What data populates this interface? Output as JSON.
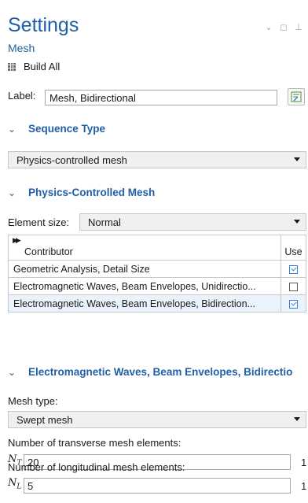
{
  "header": {
    "title": "Settings",
    "subtitle": "Mesh",
    "build_all": "Build All"
  },
  "label_field": {
    "label": "Label:",
    "value": "Mesh, Bidirectional"
  },
  "sections": {
    "sequence_type": {
      "title": "Sequence Type",
      "selected": "Physics-controlled mesh"
    },
    "physics_mesh": {
      "title": "Physics-Controlled Mesh",
      "element_size_label": "Element size:",
      "element_size_value": "Normal",
      "table": {
        "col_contributor": "Contributor",
        "col_use": "Use",
        "rows": [
          {
            "name": "Geometric Analysis, Detail Size",
            "use": true
          },
          {
            "name": "Electromagnetic Waves, Beam Envelopes, Unidirectio...",
            "use": false
          },
          {
            "name": "Electromagnetic Waves, Beam Envelopes, Bidirection...",
            "use": true
          }
        ]
      }
    },
    "ewbe": {
      "title": "Electromagnetic Waves, Beam Envelopes, Bidirectio",
      "mesh_type_label": "Mesh type:",
      "mesh_type_value": "Swept mesh",
      "transverse_label": "Number of transverse mesh elements:",
      "transverse_var": "N",
      "transverse_sub": "T",
      "transverse_value": "20",
      "transverse_unit": "1",
      "longitudinal_label": "Number of longitudinal mesh elements:",
      "longitudinal_var": "N",
      "longitudinal_sub": "L",
      "longitudinal_value": "5",
      "longitudinal_unit": "1"
    }
  },
  "colors": {
    "accent": "#1f5fa8",
    "check": "#2f7fd6",
    "selected_row": "#eaf2fb"
  }
}
